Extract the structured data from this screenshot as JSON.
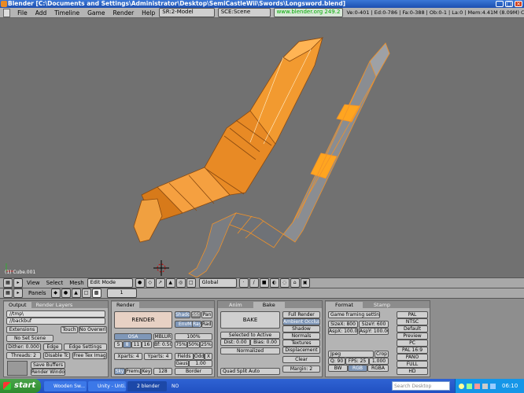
{
  "title_bar": {
    "text": "Blender [C:\\Documents and Settings\\Administrator\\Desktop\\SemiCastleWii\\Swords\\Longsword.blend]"
  },
  "menu": {
    "items": [
      "File",
      "Add",
      "Timeline",
      "Game",
      "Render",
      "Help"
    ],
    "screen": "SR:2-Model",
    "scene": "SCE:Scene",
    "url": "www.blender.org 249.2",
    "stats": "Ve:0-401 | Ed:0-786 | Fa:0-388 | Ob:0-1 | La:0 | Mem:4.41M (8.09M) Cube.001"
  },
  "viewport": {
    "label": "(1) Cube.001"
  },
  "view3d_header": {
    "menus": [
      "View",
      "Select",
      "Mesh"
    ],
    "mode": "Edit Mode",
    "orientation": "Global"
  },
  "panels_header": {
    "label": "Panels",
    "page": "1"
  },
  "output_panel": {
    "tabs": [
      "Output",
      "Render Layers"
    ],
    "path1": "//tmp\\",
    "path2": "//backbuf",
    "extensions": "Extensions",
    "touch": "Touch",
    "no_overwrite": "No Overwrite",
    "no_set_scene": "No Set Scene",
    "dither": "Dither: 0.000",
    "edge": "Edge",
    "edge_settings": "Edge Settings",
    "threads": "Threads: 2",
    "disable_tc": "Disable Tc",
    "free_tex": "Free Tex Imag",
    "save_buffers": "Save Buffers",
    "render_window": "Render Window"
  },
  "render_panel": {
    "tab": "Render",
    "render": "RENDER",
    "shadow": "Shado",
    "sss": "SSS",
    "pano": "Pan",
    "envmap": "EnvMa",
    "ray": "Ray",
    "radio": "Radi",
    "osa": "OSA",
    "mblur": "MBLUR",
    "pct100": "100%",
    "osa_levels": [
      "5",
      "8",
      "11",
      "16"
    ],
    "bf": "Bf: 0.50",
    "pct75": "75%",
    "pct50": "50%",
    "pct25": "25%",
    "xparts": "Xparts: 4",
    "yparts": "Yparts: 4",
    "fields": "Fields",
    "odd": "Odd",
    "x": "X",
    "gauss": "Gaus",
    "gauss_val": "1.00",
    "sky": "Sky",
    "premul": "Premul",
    "key": "Key",
    "depth": "128",
    "border": "Border"
  },
  "bake_panel": {
    "tabs": [
      "Anim",
      "Bake"
    ],
    "bake": "BAKE",
    "selected_to_active": "Selected to Active",
    "dist": "Dist: 0.00",
    "bias": "Bias: 0.00",
    "normalized": "Normalized",
    "quad_split": "Quad Split Auto",
    "options": [
      "Full Render",
      "Ambient Occlusi",
      "Shadow",
      "Normals",
      "Textures",
      "Displacement"
    ],
    "clear": "Clear",
    "margin": "Margin: 2"
  },
  "format_panel": {
    "tabs": [
      "Format",
      "Stamp"
    ],
    "game_framing": "Game framing settings",
    "sizex": "SizeX: 800",
    "sizey": "SizeY: 600",
    "aspx": "AspX: 100.00",
    "aspy": "AspY: 100.00",
    "jpeg": "Jpeg",
    "crop": "Crop",
    "quality": "Q: 90",
    "fps": "FPS: 25",
    "fps_base": "1.000",
    "bw": "BW",
    "rgb": "RGB",
    "rgba": "RGBA",
    "presets": [
      "PAL",
      "NTSC",
      "Default",
      "Preview",
      "PC",
      "PAL 16:9",
      "PANO",
      "FULL",
      "HD"
    ]
  },
  "taskbar": {
    "start": "start",
    "tasks": [
      "Wooden Sw...",
      "Unity - Unti...",
      "2 blender",
      "NO"
    ],
    "search_placeholder": "Search Desktop",
    "clock": "06:10"
  },
  "colors": {
    "edge_orange": "#f0922a",
    "mesh_gray": "#7a7d84"
  }
}
